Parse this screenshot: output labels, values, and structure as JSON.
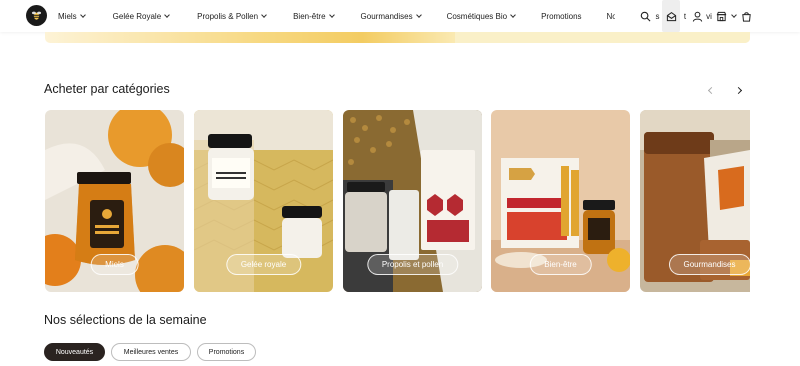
{
  "nav": {
    "items": [
      {
        "label": "Miels",
        "dropdown": true
      },
      {
        "label": "Gelée Royale",
        "dropdown": true
      },
      {
        "label": "Propolis & Pollen",
        "dropdown": true
      },
      {
        "label": "Bien-être",
        "dropdown": true
      },
      {
        "label": "Gourmandises",
        "dropdown": true
      },
      {
        "label": "Cosmétiques Bio",
        "dropdown": true
      },
      {
        "label": "Promotions",
        "dropdown": false
      },
      {
        "label": "Nouv",
        "dropdown": false
      }
    ],
    "icon_fragments": [
      "s",
      "t",
      "vi"
    ],
    "icons": [
      "search-icon",
      "mail-icon",
      "user-icon",
      "store-icon",
      "cart-icon"
    ]
  },
  "categories": {
    "title": "Acheter par catégories",
    "cards": [
      {
        "label": "Miels"
      },
      {
        "label": "Gelée royale"
      },
      {
        "label": "Propolis et pollen"
      },
      {
        "label": "Bien-être"
      },
      {
        "label": "Gourmandises"
      }
    ]
  },
  "selections": {
    "title": "Nos sélections de la semaine",
    "tabs": [
      {
        "label": "Nouveautés",
        "active": true
      },
      {
        "label": "Meilleures ventes",
        "active": false
      },
      {
        "label": "Promotions",
        "active": false
      }
    ]
  },
  "colors": {
    "accent_dark": "#2a2320",
    "hero_yellow": "#f3cc62"
  }
}
